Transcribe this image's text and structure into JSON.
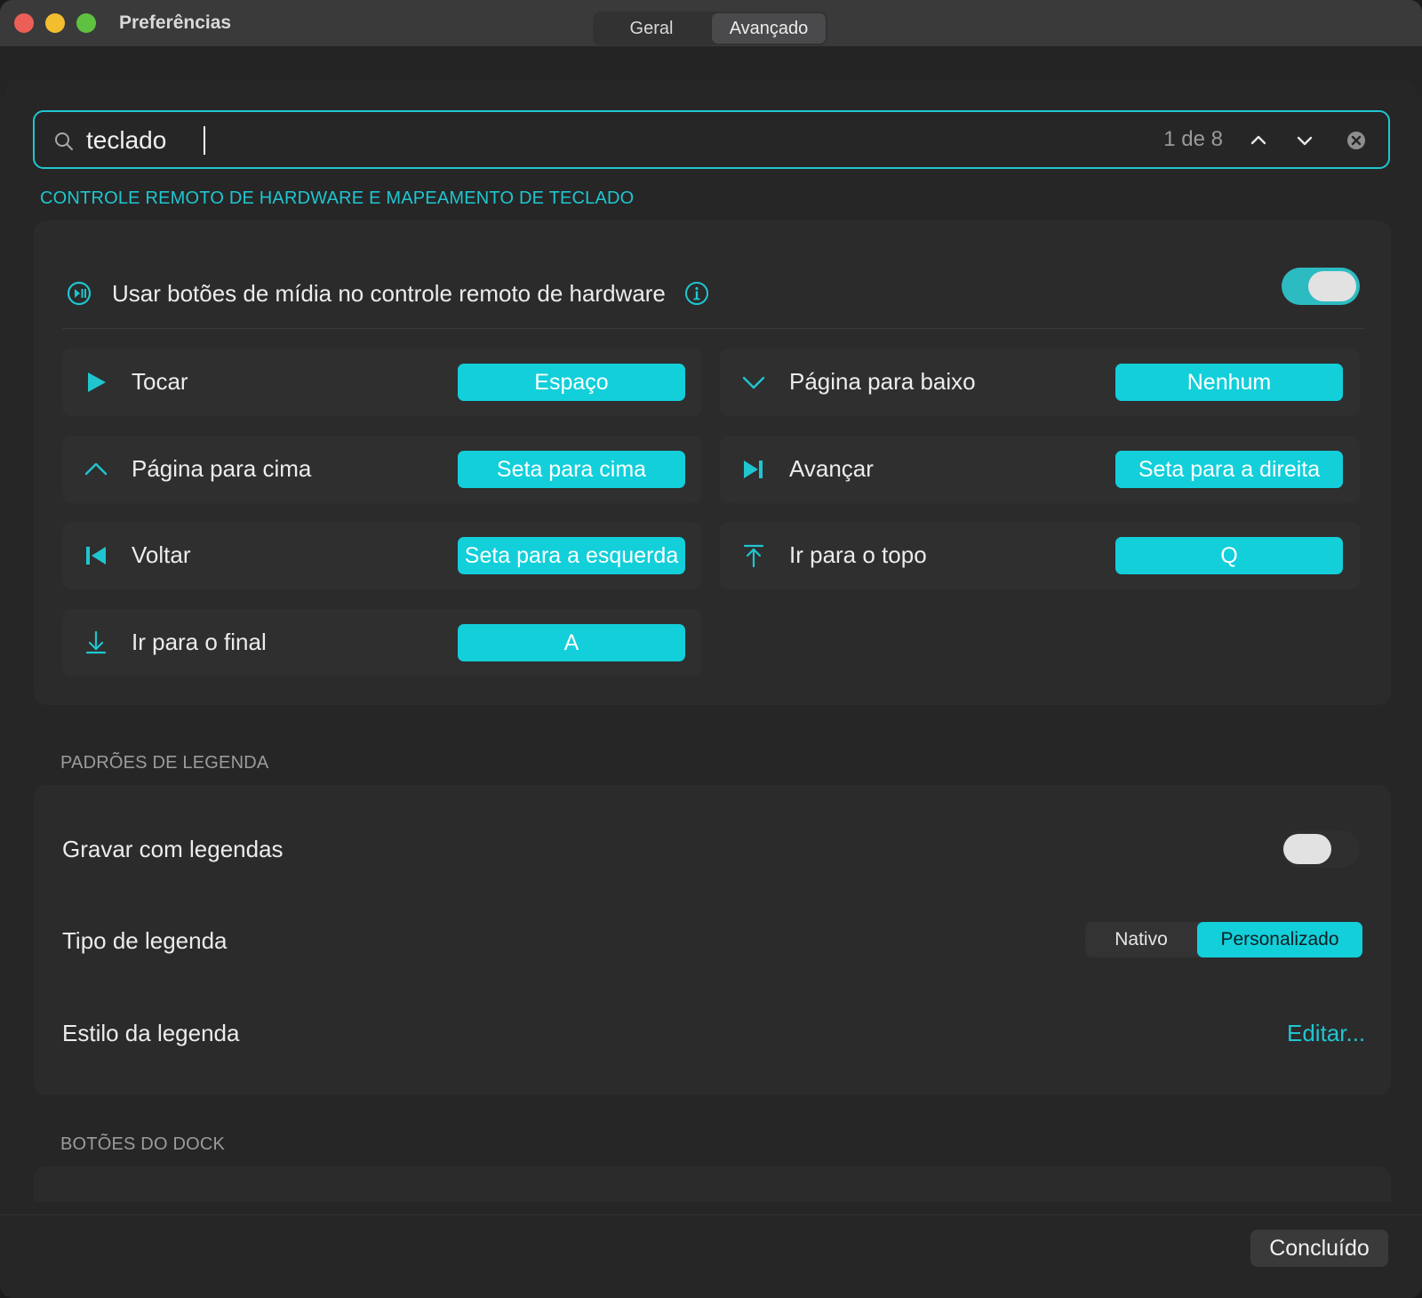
{
  "window": {
    "title": "Preferências"
  },
  "tabs": [
    {
      "label": "Geral",
      "active": false
    },
    {
      "label": "Avançado",
      "active": true
    }
  ],
  "search": {
    "value": "teclado",
    "match_count": "1 de 8"
  },
  "sections": {
    "hardware": {
      "title": "CONTROLE REMOTO DE HARDWARE E MAPEAMENTO DE TECLADO",
      "media_buttons_label": "Usar botões de mídia no controle remoto de hardware",
      "media_buttons_enabled": true,
      "shortcuts": [
        {
          "label": "Tocar",
          "key": "Espaço",
          "icon": "play-icon"
        },
        {
          "label": "Página para baixo",
          "key": "Nenhum",
          "icon": "chevron-down-icon"
        },
        {
          "label": "Página para cima",
          "key": "Seta para cima",
          "icon": "chevron-up-icon"
        },
        {
          "label": "Avançar",
          "key": "Seta para a direita",
          "icon": "skip-forward-icon"
        },
        {
          "label": "Voltar",
          "key": "Seta para a esquerda",
          "icon": "skip-back-icon"
        },
        {
          "label": "Ir para o topo",
          "key": "Q",
          "icon": "arrow-to-top-icon"
        },
        {
          "label": "Ir para o final",
          "key": "A",
          "icon": "arrow-to-bottom-icon"
        }
      ]
    },
    "legenda": {
      "title": "PADRÕES DE LEGENDA",
      "record_label": "Gravar com legendas",
      "record_enabled": false,
      "type_label": "Tipo de legenda",
      "type_options": [
        "Nativo",
        "Personalizado"
      ],
      "type_selected": "Personalizado",
      "style_label": "Estilo da legenda",
      "style_action": "Editar..."
    },
    "dock": {
      "title": "BOTÕES DO DOCK"
    }
  },
  "footer": {
    "done_label": "Concluído"
  },
  "colors": {
    "accent": "#12cfda",
    "background": "#262627",
    "card": "#2b2b2c"
  }
}
